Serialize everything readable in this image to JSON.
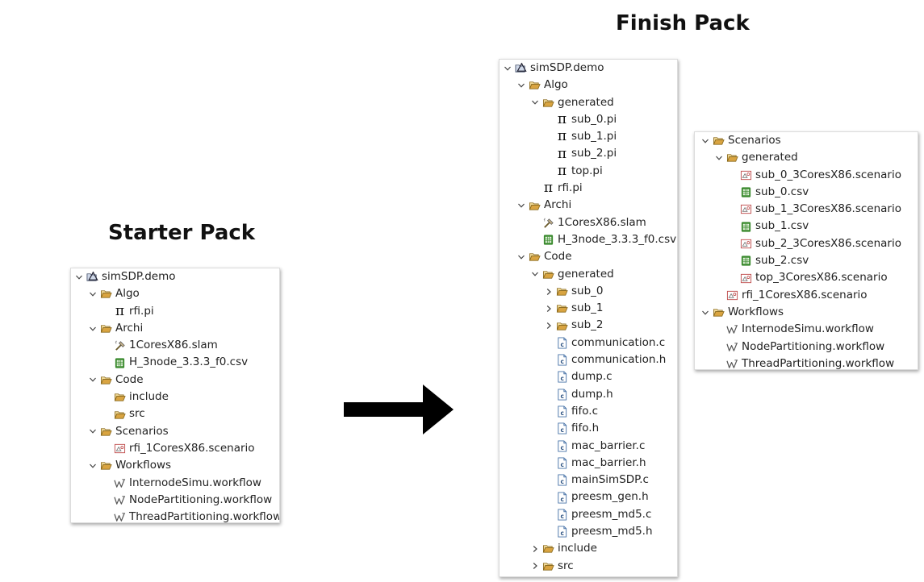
{
  "starter": {
    "title": "Starter Pack",
    "tree": [
      {
        "label": "simSDP.demo",
        "icon": "project-icon",
        "expanded": true,
        "level": 0
      },
      {
        "label": "Algo",
        "icon": "folder-icon",
        "expanded": true,
        "level": 1
      },
      {
        "label": "rfi.pi",
        "icon": "pi-icon",
        "level": 2
      },
      {
        "label": "Archi",
        "icon": "folder-icon",
        "expanded": true,
        "level": 1
      },
      {
        "label": "1CoresX86.slam",
        "icon": "slam-icon",
        "level": 2
      },
      {
        "label": "H_3node_3.3.3_f0.csv",
        "icon": "csv-icon",
        "level": 2
      },
      {
        "label": "Code",
        "icon": "folder-icon",
        "expanded": true,
        "level": 1
      },
      {
        "label": "include",
        "icon": "folder-icon",
        "level": 2
      },
      {
        "label": "src",
        "icon": "folder-icon",
        "level": 2
      },
      {
        "label": "Scenarios",
        "icon": "folder-icon",
        "expanded": true,
        "level": 1
      },
      {
        "label": "rfi_1CoresX86.scenario",
        "icon": "scenario-icon",
        "level": 2
      },
      {
        "label": "Workflows",
        "icon": "folder-icon",
        "expanded": true,
        "level": 1
      },
      {
        "label": "InternodeSimu.workflow",
        "icon": "workflow-icon",
        "level": 2
      },
      {
        "label": "NodePartitioning.workflow",
        "icon": "workflow-icon",
        "level": 2
      },
      {
        "label": "ThreadPartitioning.workflow",
        "icon": "workflow-icon",
        "level": 2
      }
    ]
  },
  "finish": {
    "title": "Finish Pack",
    "tree": [
      {
        "label": "simSDP.demo",
        "icon": "project-icon",
        "expanded": true,
        "level": 0
      },
      {
        "label": "Algo",
        "icon": "folder-icon",
        "expanded": true,
        "level": 1
      },
      {
        "label": "generated",
        "icon": "folder-icon",
        "expanded": true,
        "level": 2
      },
      {
        "label": "sub_0.pi",
        "icon": "pi-icon",
        "level": 3
      },
      {
        "label": "sub_1.pi",
        "icon": "pi-icon",
        "level": 3
      },
      {
        "label": "sub_2.pi",
        "icon": "pi-icon",
        "level": 3
      },
      {
        "label": "top.pi",
        "icon": "pi-icon",
        "level": 3
      },
      {
        "label": "rfi.pi",
        "icon": "pi-icon",
        "level": 2
      },
      {
        "label": "Archi",
        "icon": "folder-icon",
        "expanded": true,
        "level": 1
      },
      {
        "label": "1CoresX86.slam",
        "icon": "slam-icon",
        "level": 2
      },
      {
        "label": "H_3node_3.3.3_f0.csv",
        "icon": "csv-icon",
        "level": 2
      },
      {
        "label": "Code",
        "icon": "folder-icon",
        "expanded": true,
        "level": 1
      },
      {
        "label": "generated",
        "icon": "folder-icon",
        "expanded": true,
        "level": 2
      },
      {
        "label": "sub_0",
        "icon": "folder-icon",
        "expanded": false,
        "level": 3
      },
      {
        "label": "sub_1",
        "icon": "folder-icon",
        "expanded": false,
        "level": 3
      },
      {
        "label": "sub_2",
        "icon": "folder-icon",
        "expanded": false,
        "level": 3
      },
      {
        "label": "communication.c",
        "icon": "c-file-icon",
        "level": 3
      },
      {
        "label": "communication.h",
        "icon": "c-file-icon",
        "level": 3
      },
      {
        "label": "dump.c",
        "icon": "c-file-icon",
        "level": 3
      },
      {
        "label": "dump.h",
        "icon": "c-file-icon",
        "level": 3
      },
      {
        "label": "fifo.c",
        "icon": "c-file-icon",
        "level": 3
      },
      {
        "label": "fifo.h",
        "icon": "c-file-icon",
        "level": 3
      },
      {
        "label": "mac_barrier.c",
        "icon": "c-file-icon",
        "level": 3
      },
      {
        "label": "mac_barrier.h",
        "icon": "c-file-icon",
        "level": 3
      },
      {
        "label": "mainSimSDP.c",
        "icon": "c-file-icon",
        "level": 3
      },
      {
        "label": "preesm_gen.h",
        "icon": "c-file-icon",
        "level": 3
      },
      {
        "label": "preesm_md5.c",
        "icon": "c-file-icon",
        "level": 3
      },
      {
        "label": "preesm_md5.h",
        "icon": "c-file-icon",
        "level": 3
      },
      {
        "label": "include",
        "icon": "folder-icon",
        "expanded": false,
        "level": 2
      },
      {
        "label": "src",
        "icon": "folder-icon",
        "expanded": false,
        "level": 2
      }
    ],
    "scenarios_tree": [
      {
        "label": "Scenarios",
        "icon": "folder-icon",
        "expanded": true,
        "level": 1
      },
      {
        "label": "generated",
        "icon": "folder-icon",
        "expanded": true,
        "level": 2
      },
      {
        "label": "sub_0_3CoresX86.scenario",
        "icon": "scenario-icon",
        "level": 3
      },
      {
        "label": "sub_0.csv",
        "icon": "csv-icon",
        "level": 3
      },
      {
        "label": "sub_1_3CoresX86.scenario",
        "icon": "scenario-icon",
        "level": 3
      },
      {
        "label": "sub_1.csv",
        "icon": "csv-icon",
        "level": 3
      },
      {
        "label": "sub_2_3CoresX86.scenario",
        "icon": "scenario-icon",
        "level": 3
      },
      {
        "label": "sub_2.csv",
        "icon": "csv-icon",
        "level": 3
      },
      {
        "label": "top_3CoresX86.scenario",
        "icon": "scenario-icon",
        "level": 3
      },
      {
        "label": "rfi_1CoresX86.scenario",
        "icon": "scenario-icon",
        "level": 2
      },
      {
        "label": "Workflows",
        "icon": "folder-icon",
        "expanded": true,
        "level": 1
      },
      {
        "label": "InternodeSimu.workflow",
        "icon": "workflow-icon",
        "level": 2
      },
      {
        "label": "NodePartitioning.workflow",
        "icon": "workflow-icon",
        "level": 2
      },
      {
        "label": "ThreadPartitioning.workflow",
        "icon": "workflow-icon",
        "level": 2
      }
    ]
  },
  "arrow": {
    "icon": "right-arrow-icon",
    "color": "#000000"
  },
  "colors": {
    "folder": "#d9a441",
    "csv": "#3a8a2e",
    "c_file": "#4a74a8",
    "scenario": "#c05050"
  }
}
